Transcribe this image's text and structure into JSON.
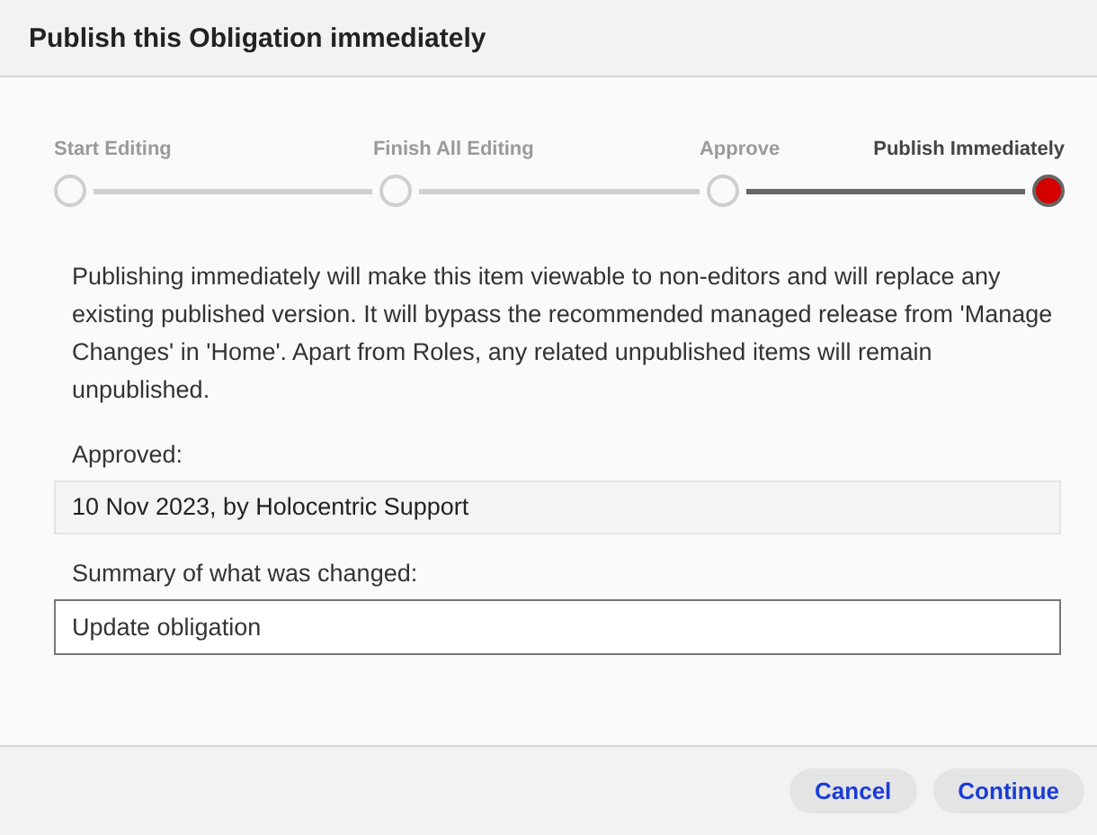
{
  "dialog": {
    "title": "Publish this Obligation immediately"
  },
  "steps": [
    {
      "label": "Start Editing",
      "selected": false
    },
    {
      "label": "Finish All Editing",
      "selected": false
    },
    {
      "label": "Approve",
      "selected": false
    },
    {
      "label": "Publish Immediately",
      "selected": true
    }
  ],
  "message": "Publishing immediately will make this item viewable to non-editors and will replace any existing published version. It will bypass the recommended managed release from 'Manage Changes' in 'Home'. Apart from Roles, any related unpublished items will remain unpublished.",
  "approved": {
    "label": "Approved:",
    "value": "10 Nov 2023, by Holocentric Support"
  },
  "summary": {
    "label": "Summary of what was changed:",
    "value": "Update obligation"
  },
  "buttons": [
    "Cancel",
    "Continue"
  ]
}
